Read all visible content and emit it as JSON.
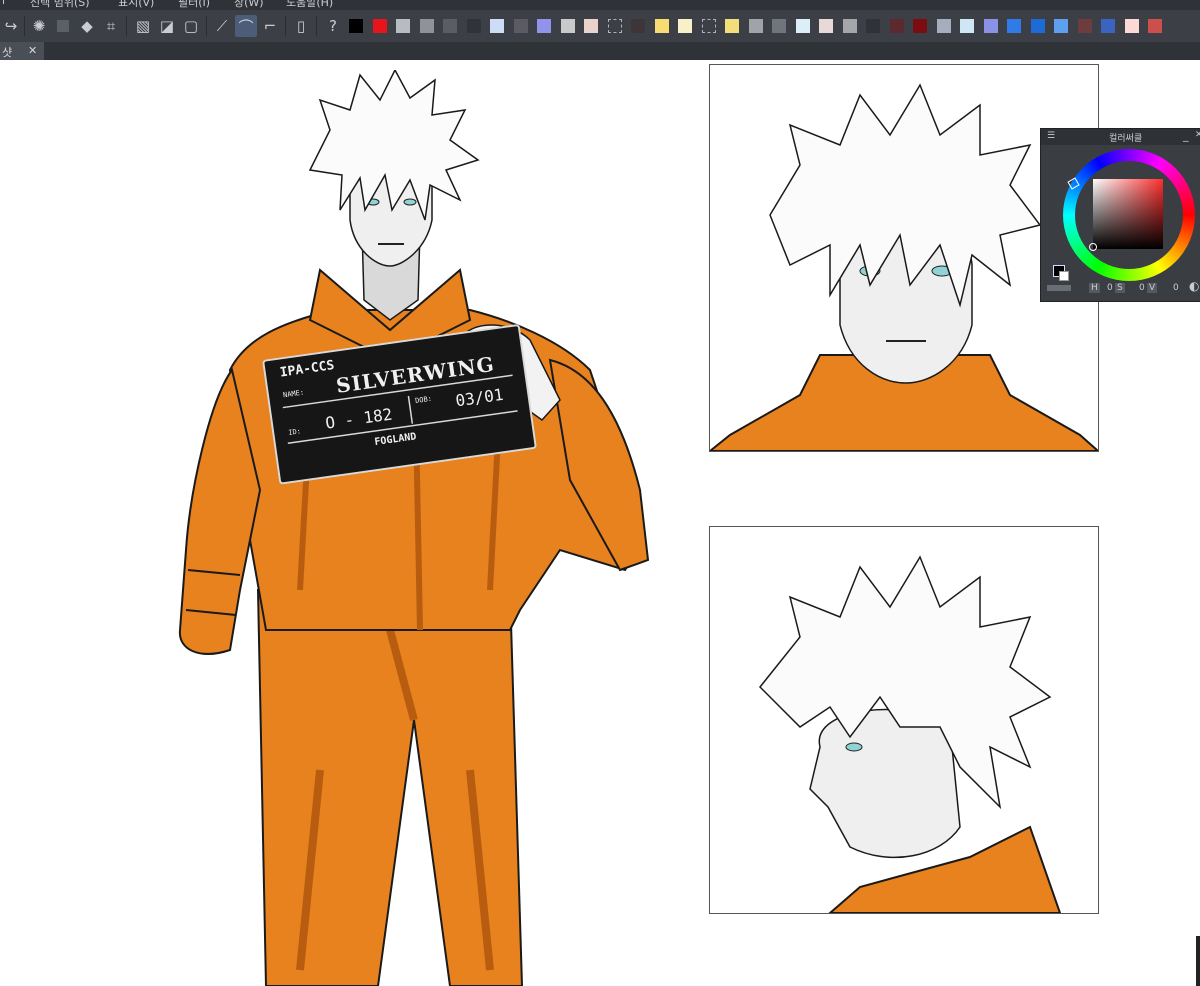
{
  "menubar": {
    "items": [
      {
        "label": "l"
      },
      {
        "label": "선택 범위(S)"
      },
      {
        "label": "표시(V)"
      },
      {
        "label": "필터(I)"
      },
      {
        "label": "창(W)"
      },
      {
        "label": "도움말(H)"
      }
    ]
  },
  "toolbar": {
    "swatches": [
      "#000000",
      "#e8141b",
      "#b8bcc2",
      "#8f9399",
      "#5a5e64",
      "#30333a",
      "#cfdcf8",
      "#5b5b66",
      "#8f93ea",
      "#c9c9cc",
      "#ead2cd",
      "empty",
      "#3e3539",
      "#f6dc72",
      "#f8f0c8",
      "empty",
      "#f4de7c",
      "#a0a3a8",
      "#70757c",
      "#dceef8",
      "#e8d8d8",
      "#a4a6a9",
      "#2f3339",
      "#5c2a2e",
      "#7a0c12",
      "#a4aebd",
      "#cfe6f5",
      "#8a92e6",
      "#2f7ce8",
      "#1d6bd6",
      "#5fa0ee",
      "#6e3c3f",
      "#3b63c0",
      "#fbd9d6",
      "#cc4f4c"
    ]
  },
  "tab": {
    "label": "샷",
    "close": "✕"
  },
  "mugshot": {
    "org": "IPA-CCS",
    "name_label": "NAME:",
    "name": "SILVERWING",
    "dob_label": "DOB:",
    "dob": "03/01",
    "id_label": "ID:",
    "id": "O - 182",
    "place": "FOGLAND"
  },
  "color_panel": {
    "title": "컬러써클",
    "h_label": "H",
    "h_value": "0",
    "s_label": "S",
    "s_value": "0",
    "v_label": "V",
    "v_value": "0",
    "accent": "#8b1e22"
  }
}
